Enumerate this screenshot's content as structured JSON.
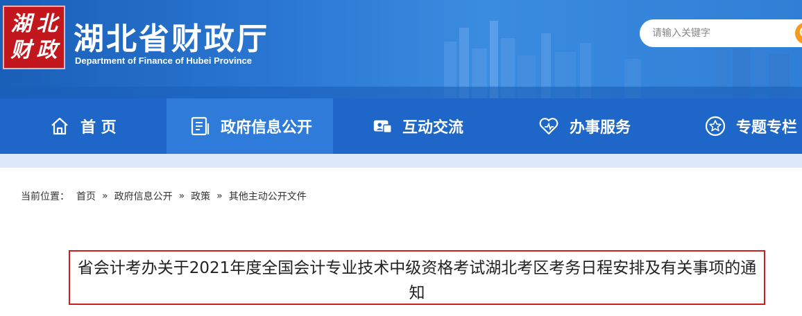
{
  "header": {
    "seal_chars": [
      "湖",
      "北",
      "财",
      "政"
    ],
    "title": "湖北省财政厅",
    "subtitle": "Department of Finance of Hubei Province",
    "search_placeholder": "请输入关键字"
  },
  "nav": {
    "items": [
      {
        "label": "首 页",
        "icon": "home-icon",
        "active": false
      },
      {
        "label": "政府信息公开",
        "icon": "document-icon",
        "active": true
      },
      {
        "label": "互动交流",
        "icon": "chat-icon",
        "active": false
      },
      {
        "label": "办事服务",
        "icon": "heart-icon",
        "active": false
      },
      {
        "label": "专题专栏",
        "icon": "star-icon",
        "active": false
      }
    ]
  },
  "breadcrumb": {
    "prefix": "当前位置：",
    "items": [
      "首页",
      "政府信息公开",
      "政策",
      "其他主动公开文件"
    ],
    "separator": "»"
  },
  "article": {
    "title": "省会计考办关于2021年度全国会计专业技术中级资格考试湖北考区考务日程安排及有关事项的通知"
  },
  "colors": {
    "header_blue": "#2a77d2",
    "nav_blue": "#1e66c7",
    "nav_active": "#2e7bd9",
    "seal_red": "#c2171d",
    "search_orange": "#f29b1d",
    "highlight_red": "#c81e1e"
  }
}
